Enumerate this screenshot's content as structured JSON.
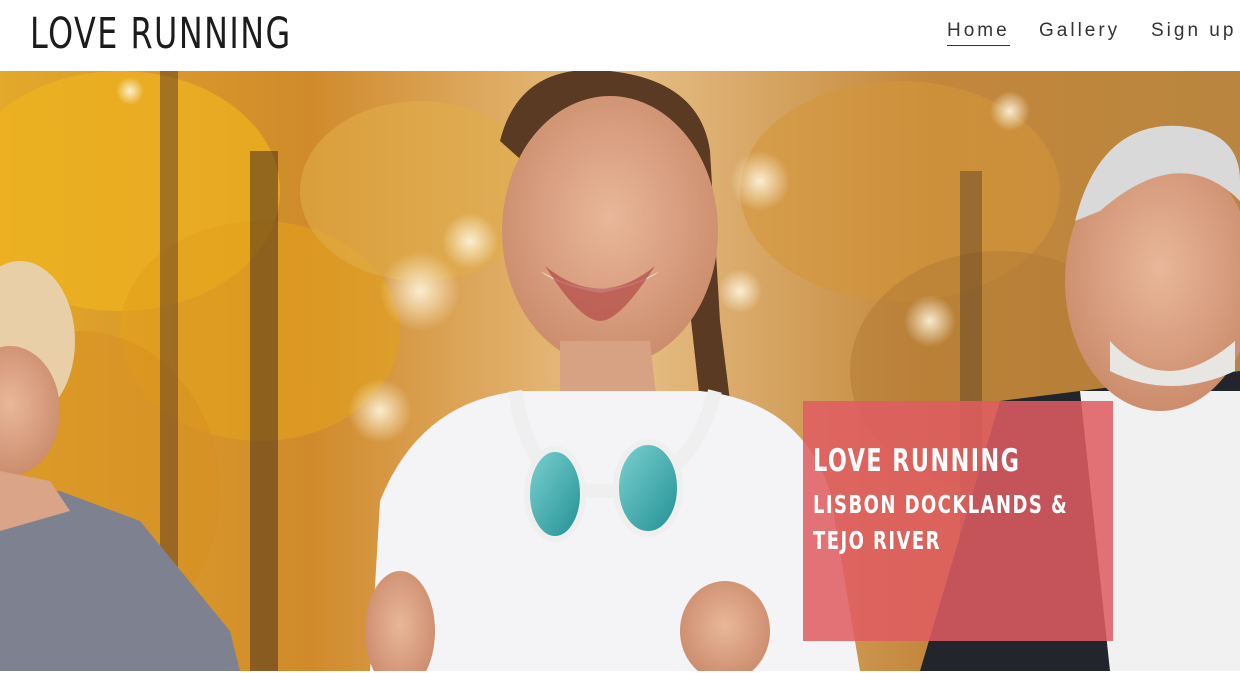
{
  "header": {
    "logo": "LOVE RUNNING",
    "nav": [
      {
        "label": "Home",
        "active": true
      },
      {
        "label": "Gallery",
        "active": false
      },
      {
        "label": "Sign up",
        "active": false
      }
    ]
  },
  "hero": {
    "overlay_title": "LOVE RUNNING",
    "overlay_subtitle": "LISBON DOCKLANDS & TEJO RIVER",
    "overlay_color": "#e05c62"
  }
}
